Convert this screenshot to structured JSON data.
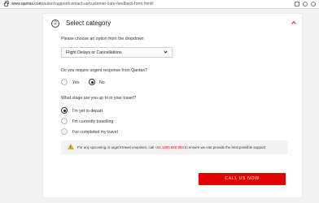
{
  "browser": {
    "url_host": "www.qantas.com",
    "url_path": "/au/en/support/contact-us/customer-care-feedback-form.html#"
  },
  "section": {
    "step_number": "2",
    "title": "Select category"
  },
  "category": {
    "prompt": "Please choose an option from the dropdown",
    "selected_value": "Flight Delays or Cancellations"
  },
  "urgent": {
    "question": "Do you require urgent response from Qantas?",
    "options": [
      {
        "label": "Yes",
        "checked": false
      },
      {
        "label": "No",
        "checked": true
      }
    ]
  },
  "travel_stage": {
    "question": "What stage are you up to in your travel?",
    "options": [
      {
        "label": "I'm yet to depart",
        "checked": true
      },
      {
        "label": "I'm currently travelling",
        "checked": false
      },
      {
        "label": "I've completed my travel",
        "checked": false
      }
    ]
  },
  "notice": {
    "text_before": "For any upcoming or urgent travel enquiries, call ",
    "phone": "+61 1300 650 363",
    "text_after": " to ensure we can provide the best possible support"
  },
  "actions": {
    "call_label": "CALL US NOW"
  },
  "colors": {
    "accent": "#e40000",
    "warning": "#e8a317"
  }
}
